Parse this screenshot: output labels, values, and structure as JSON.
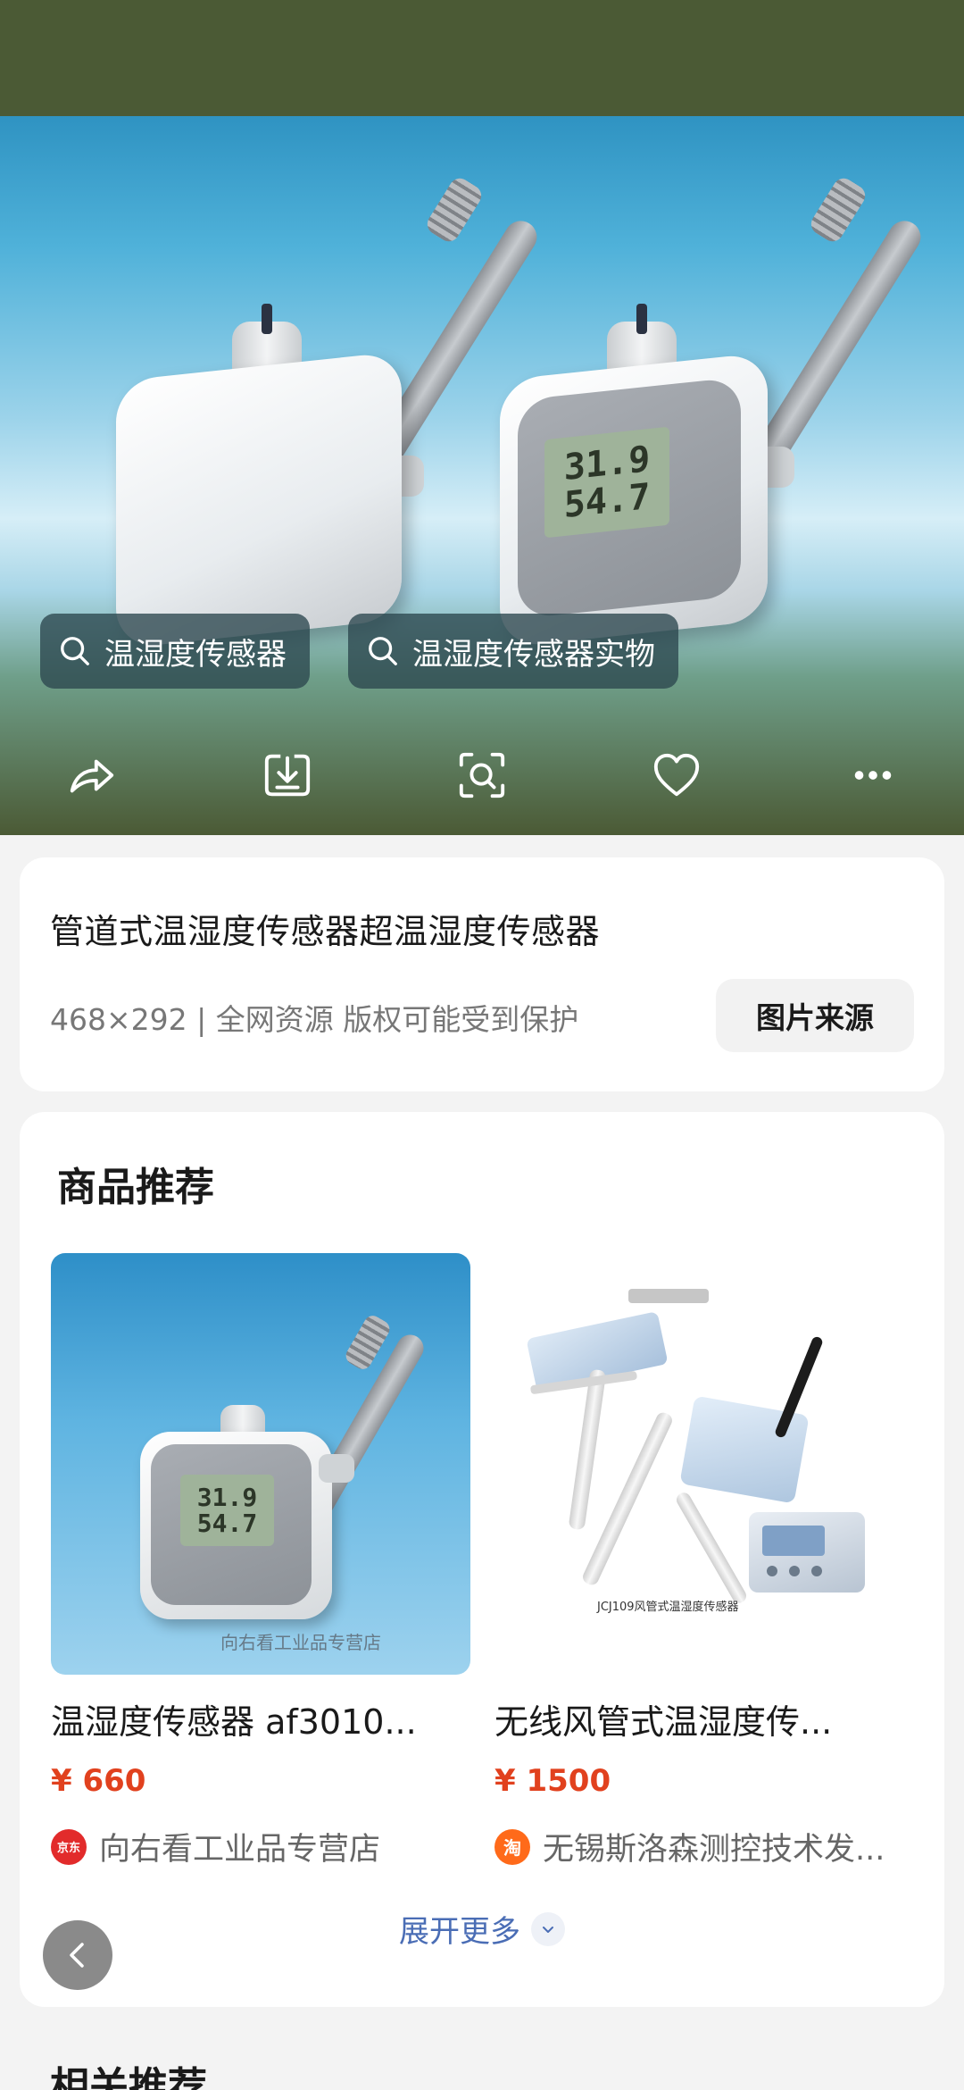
{
  "search_chips": [
    {
      "label": "温湿度传感器",
      "icon": "search-icon"
    },
    {
      "label": "温湿度传感器实物",
      "icon": "search-icon"
    }
  ],
  "actions": [
    {
      "name": "share",
      "icon": "share-icon"
    },
    {
      "name": "download",
      "icon": "download-icon"
    },
    {
      "name": "visual-search",
      "icon": "lens-scan-icon"
    },
    {
      "name": "favorite",
      "icon": "heart-icon"
    },
    {
      "name": "more",
      "icon": "more-dots-icon"
    }
  ],
  "hero_lcd": {
    "line1": "31.9",
    "line2": "54.7"
  },
  "image_info": {
    "title": "管道式温湿度传感器超温湿度传感器",
    "meta": "468×292 | 全网资源 版权可能受到保护",
    "source_button": "图片来源"
  },
  "products_section": {
    "title": "商品推荐",
    "items": [
      {
        "name": "温湿度传感器 af3010...",
        "price": "¥ 660",
        "store": "向右看工业品专营店",
        "store_badge": "京东",
        "badge_color": "#e22b2b",
        "image_watermark": "向右看工业品专营店",
        "lcd_line1": "31.9",
        "lcd_line2": "54.7"
      },
      {
        "name": "无线风管式温湿度传...",
        "price": "¥ 1500",
        "store": "无锡斯洛森测控技术发...",
        "store_badge": "淘",
        "badge_color": "#ff6a1a",
        "image_caption": "JCJ109风管式温湿度传感器"
      }
    ],
    "expand_label": "展开更多"
  },
  "related_title": "相关推荐",
  "colors": {
    "hero_bg": "#4b5a35",
    "price": "#e1411e",
    "link": "#4a6db5"
  }
}
